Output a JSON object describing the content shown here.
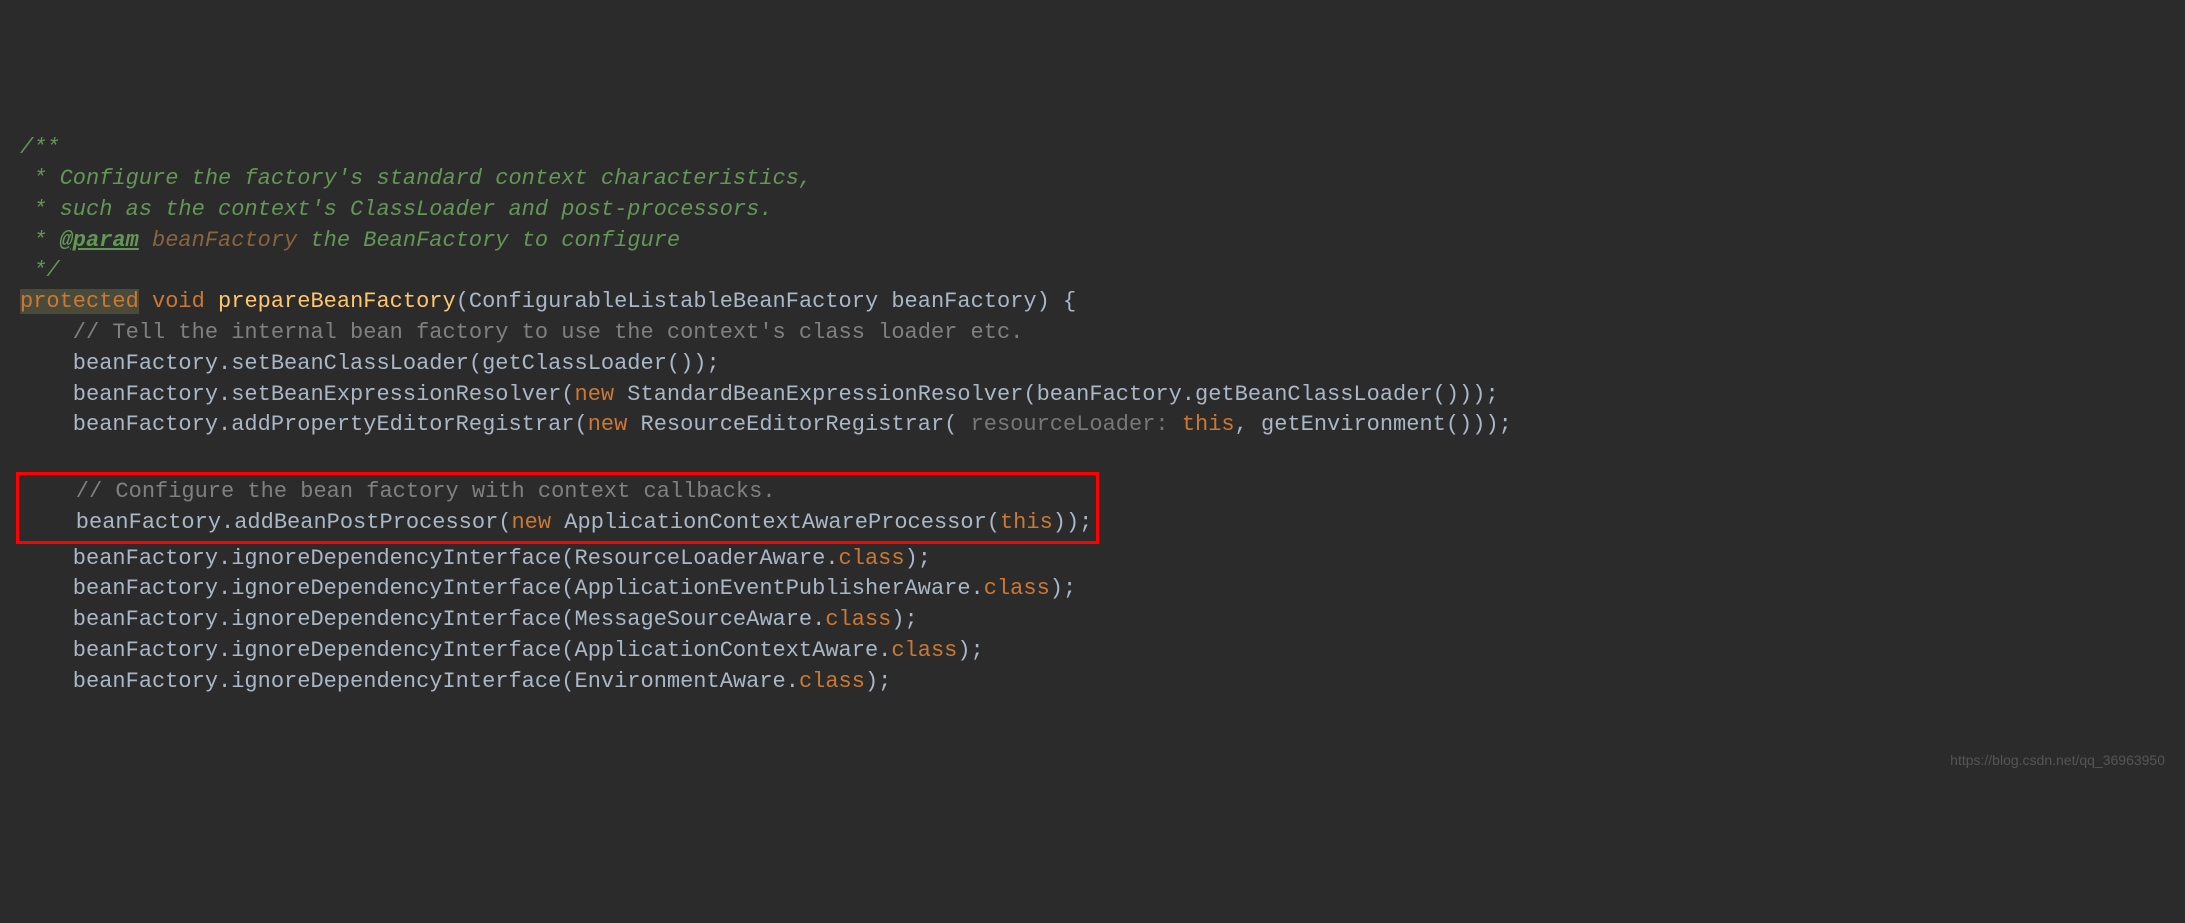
{
  "doc": {
    "l1": "/**",
    "l2": " * Configure the factory's standard context characteristics,",
    "l3": " * such as the context's ClassLoader and post-processors.",
    "l4_prefix": " * ",
    "l4_tag": "@param",
    "l4_param": " beanFactory",
    "l4_rest": " the BeanFactory to configure",
    "l5": " */"
  },
  "sig": {
    "protected": "protected",
    "void": " void ",
    "name": "prepareBeanFactory",
    "params": "(ConfigurableListableBeanFactory beanFactory) {"
  },
  "c1": "    // Tell the internal bean factory to use the context's class loader etc.",
  "l1": "    beanFactory.setBeanClassLoader(getClassLoader());",
  "l2_a": "    beanFactory.setBeanExpressionResolver(",
  "l2_new": "new",
  "l2_b": " StandardBeanExpressionResolver(beanFactory.getBeanClassLoader()));",
  "l3_a": "    beanFactory.addPropertyEditorRegistrar(",
  "l3_new": "new",
  "l3_b": " ResourceEditorRegistrar(",
  "l3_hint": " resourceLoader: ",
  "l3_this": "this",
  "l3_c": ", getEnvironment()));",
  "c2": "    // Configure the bean factory with context callbacks.",
  "l4_a": "    beanFactory.addBeanPostProcessor(",
  "l4_new": "new",
  "l4_b": " ApplicationContextAwareProcessor(",
  "l4_this": "this",
  "l4_c": "));",
  "l5_a": "    beanFactory.ignoreDependencyInterface(ResourceLoaderAware.",
  "l5_class": "class",
  "l5_b": ");",
  "l6_a": "    beanFactory.ignoreDependencyInterface(ApplicationEventPublisherAware.",
  "l6_class": "class",
  "l6_b": ");",
  "l7_a": "    beanFactory.ignoreDependencyInterface(MessageSourceAware.",
  "l7_class": "class",
  "l7_b": ");",
  "l8_a": "    beanFactory.ignoreDependencyInterface(ApplicationContextAware.",
  "l8_class": "class",
  "l8_b": ");",
  "l9_a": "    beanFactory.ignoreDependencyInterface(EnvironmentAware.",
  "l9_class": "class",
  "l9_b": ");",
  "watermark": "https://blog.csdn.net/qq_36963950"
}
